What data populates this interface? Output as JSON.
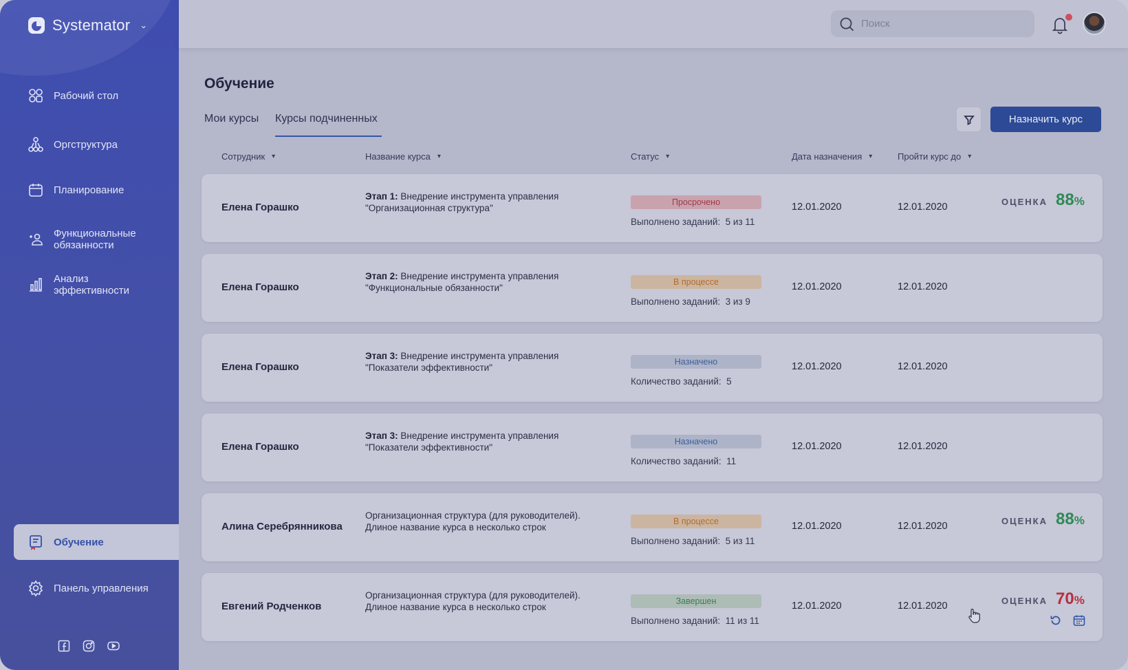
{
  "app": {
    "name": "Systemator"
  },
  "search": {
    "placeholder": "Поиск"
  },
  "sidebar": {
    "items": [
      {
        "label": "Рабочий стол",
        "icon": "dashboard-icon"
      },
      {
        "label": "Оргструктура",
        "icon": "org-structure-icon"
      },
      {
        "label": "Планирование",
        "icon": "calendar-icon"
      },
      {
        "label": "Функциональные обязанности",
        "icon": "person-duties-icon"
      },
      {
        "label": "Анализ эффективности",
        "icon": "bar-chart-icon"
      },
      {
        "label": "Обучение",
        "icon": "book-icon",
        "active": true
      },
      {
        "label": "Панель управления",
        "icon": "gear-icon"
      }
    ],
    "socials": [
      "facebook-icon",
      "instagram-icon",
      "youtube-icon"
    ]
  },
  "page": {
    "title": "Обучение",
    "tabs": [
      {
        "label": "Мои курсы"
      },
      {
        "label": "Курсы подчиненных",
        "active": true
      }
    ],
    "assign_button": "Назначить курс"
  },
  "table": {
    "columns": [
      "Сотрудник",
      "Название курса",
      "Статус",
      "Дата назначения",
      "Пройти курс до"
    ],
    "score_label": "ОЦЕНКА",
    "rows": [
      {
        "employee": "Елена Горашко",
        "stage": "Этап 1:",
        "course": "Внедрение инструмента управления \"Организационная структура\"",
        "status": "Просрочено",
        "status_kind": "overdue",
        "tasks_label": "Выполнено заданий:",
        "tasks_value": "5 из 11",
        "assigned": "12.01.2020",
        "due": "12.01.2020",
        "score": "88",
        "score_color": "#2f8a55"
      },
      {
        "employee": "Елена Горашко",
        "stage": "Этап 2:",
        "course": "Внедрение инструмента управления \"Функциональные обязанности\"",
        "status": "В процессе",
        "status_kind": "progress",
        "tasks_label": "Выполнено заданий:",
        "tasks_value": "3 из 9",
        "assigned": "12.01.2020",
        "due": "12.01.2020"
      },
      {
        "employee": "Елена Горашко",
        "stage": "Этап 3:",
        "course": "Внедрение инструмента управления \"Показатели эффективности\"",
        "status": "Назначено",
        "status_kind": "assigned",
        "tasks_label": "Количество заданий:",
        "tasks_value": "5",
        "assigned": "12.01.2020",
        "due": "12.01.2020"
      },
      {
        "employee": "Елена Горашко",
        "stage": "Этап 3:",
        "course": "Внедрение инструмента управления \"Показатели эффективности\"",
        "status": "Назначено",
        "status_kind": "assigned",
        "tasks_label": "Количество заданий:",
        "tasks_value": "11",
        "assigned": "12.01.2020",
        "due": "12.01.2020"
      },
      {
        "employee": "Алина Серебрянникова",
        "stage": "",
        "course": "Организационная структура (для руководителей). Длиное название курса в несколько строк",
        "status": "В процессе",
        "status_kind": "progress",
        "tasks_label": "Выполнено заданий:",
        "tasks_value": "5 из 11",
        "assigned": "12.01.2020",
        "due": "12.01.2020",
        "score": "88",
        "score_color": "#2f8a55"
      },
      {
        "employee": "Евгений Родченков",
        "stage": "",
        "course": "Организационная структура (для руководителей). Длиное название курса в несколько строк",
        "status": "Завершен",
        "status_kind": "done",
        "tasks_label": "Выполнено заданий:",
        "tasks_value": "11 из 11",
        "assigned": "12.01.2020",
        "due": "12.01.2020",
        "score": "70",
        "score_color": "#b7303e",
        "actions": [
          "retry-icon",
          "calendar-icon"
        ]
      }
    ]
  }
}
